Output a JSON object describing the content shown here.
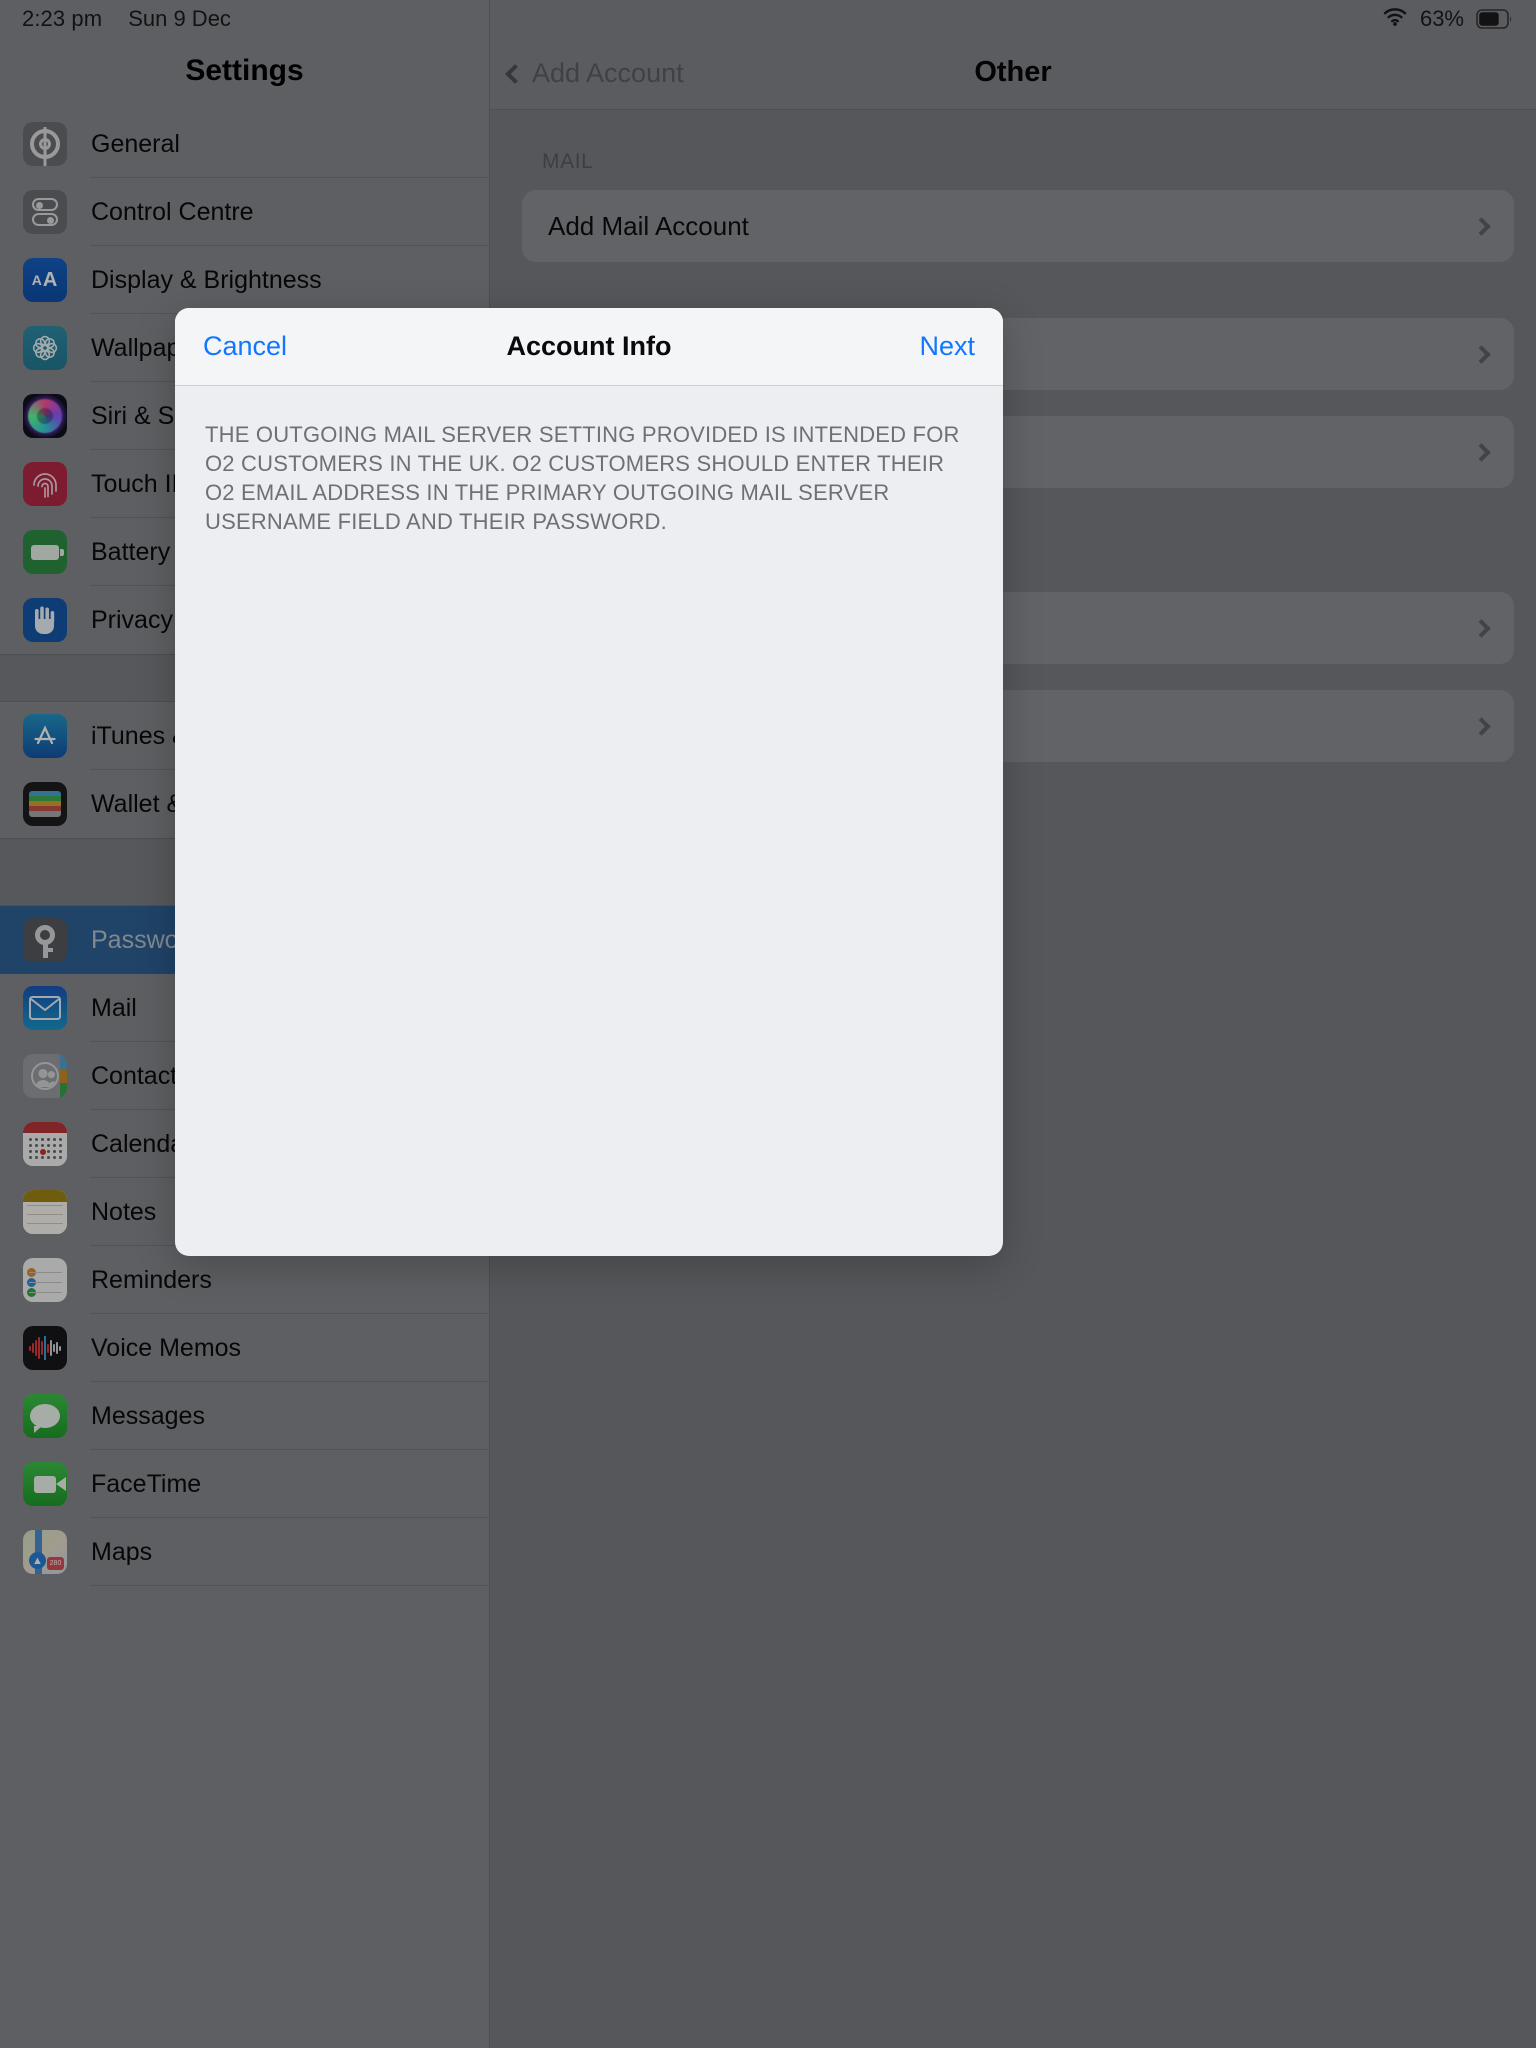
{
  "status_bar": {
    "time": "2:23 pm",
    "date": "Sun 9 Dec",
    "battery_percent": "63%",
    "wifi_icon": "wifi-icon",
    "battery_icon": "battery-icon"
  },
  "sidebar": {
    "title": "Settings",
    "groups": [
      {
        "items": [
          {
            "label": "General",
            "icon": "gear-icon"
          },
          {
            "label": "Control Centre",
            "icon": "control-centre-icon"
          },
          {
            "label": "Display & Brightness",
            "icon": "display-brightness-icon"
          },
          {
            "label": "Wallpaper",
            "icon": "wallpaper-icon"
          },
          {
            "label": "Siri & Search",
            "icon": "siri-icon"
          },
          {
            "label": "Touch ID & Passcode",
            "icon": "touch-id-icon"
          },
          {
            "label": "Battery",
            "icon": "battery-app-icon"
          },
          {
            "label": "Privacy",
            "icon": "privacy-hand-icon"
          }
        ]
      },
      {
        "items": [
          {
            "label": "iTunes & App Store",
            "icon": "app-store-icon"
          },
          {
            "label": "Wallet & Apple Pay",
            "icon": "wallet-icon"
          }
        ]
      },
      {
        "items": [
          {
            "label": "Passwords & Accounts",
            "icon": "key-icon",
            "selected": true
          },
          {
            "label": "Mail",
            "icon": "mail-icon"
          },
          {
            "label": "Contacts",
            "icon": "contacts-icon"
          },
          {
            "label": "Calendar",
            "icon": "calendar-icon"
          },
          {
            "label": "Notes",
            "icon": "notes-icon"
          },
          {
            "label": "Reminders",
            "icon": "reminders-icon"
          },
          {
            "label": "Voice Memos",
            "icon": "voice-memos-icon"
          },
          {
            "label": "Messages",
            "icon": "messages-icon"
          },
          {
            "label": "FaceTime",
            "icon": "facetime-icon"
          },
          {
            "label": "Maps",
            "icon": "maps-icon"
          }
        ]
      }
    ]
  },
  "right_pane": {
    "back_label": "Add Account",
    "back_icon": "chevron-left-icon",
    "title": "Other",
    "sections": [
      {
        "header": "MAIL",
        "rows": [
          {
            "label": "Add Mail Account",
            "chevron": true
          }
        ]
      },
      {
        "header": "",
        "rows": [
          {
            "label": "",
            "chevron": true
          },
          {
            "label": "",
            "chevron": true
          }
        ]
      },
      {
        "header": "",
        "rows": [
          {
            "label": "",
            "chevron": true
          },
          {
            "label": "",
            "chevron": true
          }
        ]
      }
    ]
  },
  "modal": {
    "cancel_label": "Cancel",
    "title": "Account Info",
    "next_label": "Next",
    "note": "THE OUTGOING MAIL SERVER SETTING PROVIDED IS INTENDED FOR O2 CUSTOMERS IN THE UK. O2 CUSTOMERS SHOULD ENTER THEIR O2 EMAIL ADDRESS IN THE PRIMARY OUTGOING MAIL SERVER USERNAME FIELD AND THEIR PASSWORD."
  },
  "colors": {
    "accent_blue": "#1277ff",
    "selected_row": "#2e6095",
    "backdrop": "#8a8c90"
  }
}
